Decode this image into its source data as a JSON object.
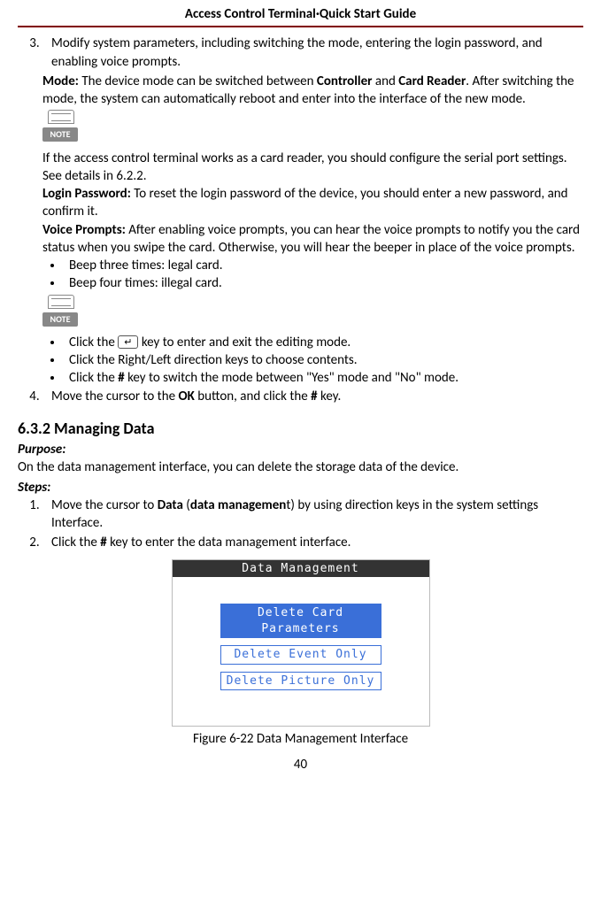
{
  "header": "Access Control Terminal·Quick Start Guide",
  "step3": {
    "num": "3.",
    "text": "Modify system parameters, including switching the mode, entering the login password, and enabling voice prompts.",
    "mode_label": "Mode:",
    "mode_text": " The device mode can be switched between ",
    "mode_b1": "Controller",
    "mode_mid": " and ",
    "mode_b2": "Card Reader",
    "mode_tail": ". After switching the mode, the system can automatically reboot and enter into the interface of the new mode.",
    "note1_text": "If the access control terminal works as a card reader, you should configure the serial port settings. See details in 6.2.2.",
    "login_label": "Login Password:",
    "login_text": " To reset the login password of the device, you should enter a new password, and confirm it.",
    "vp_label": "Voice Prompts:",
    "vp_text": " After enabling voice prompts, you can hear the voice prompts to notify you the card status when you swipe the card. Otherwise, you will hear the beeper in place of the voice prompts.",
    "beep1": "Beep three times: legal card.",
    "beep2": "Beep four times: illegal card.",
    "note2a_pre": "Click the ",
    "note2a_post": " key to enter and exit the editing mode.",
    "note2b": "Click the Right/Left direction keys to choose contents.",
    "note2c_pre": "Click the ",
    "note2c_hash": "#",
    "note2c_post": " key to switch the mode between \"Yes\" mode and \"No\" mode."
  },
  "step4": {
    "pre": "Move the cursor to the ",
    "ok": "OK",
    "mid": " button, and click the ",
    "hash": "#",
    "post": " key."
  },
  "sec": {
    "title": "6.3.2 Managing Data",
    "purpose_label": "Purpose:",
    "purpose_text": "On the data management interface, you can delete the storage data of the device.",
    "steps_label": "Steps:",
    "s1_pre": "Move the cursor to ",
    "s1_b1": "Data",
    "s1_mid1": " (",
    "s1_b2": "data managemen",
    "s1_mid2": "t) by using direction keys in the system settings Interface.",
    "s2_pre": "Click the ",
    "s2_hash": "#",
    "s2_post": " key to enter the data management interface."
  },
  "screenshot": {
    "title": "Data Management",
    "opt1": "Delete Card Parameters",
    "opt2": "Delete Event Only",
    "opt3": "Delete Picture Only"
  },
  "caption_pre": "Figure 6-22",
  "caption_post": " Data Management Interface",
  "note_badge": "NOTE",
  "key_glyph": "↵",
  "page": "40"
}
